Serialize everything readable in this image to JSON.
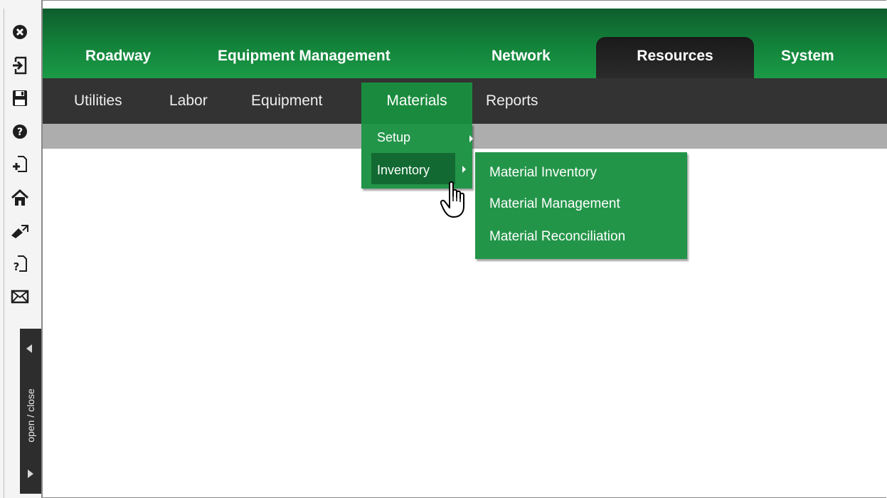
{
  "colors": {
    "nav_green": "#13843b",
    "menu_green": "#239549",
    "highlight_green": "#126a32",
    "subnav": "#333333",
    "active_tab": "#1a1a1a"
  },
  "toolbar": {
    "icons": [
      "close-circle-icon",
      "logout-icon",
      "save-icon",
      "help-icon",
      "new-page-icon",
      "home-icon",
      "edit-icon",
      "help-page-icon",
      "mail-icon"
    ],
    "open_close_label": "open / close"
  },
  "nav": {
    "tabs": [
      "Roadway",
      "Equipment Management",
      "Network",
      "Resources",
      "System"
    ],
    "active": "Resources"
  },
  "subnav": {
    "items": [
      "Utilities",
      "Labor",
      "Equipment",
      "Materials",
      "Reports"
    ],
    "active": "Materials"
  },
  "materials_menu": {
    "items": [
      "Setup",
      "Inventory"
    ],
    "highlighted": "Inventory"
  },
  "inventory_menu": {
    "items": [
      "Material Inventory",
      "Material Management",
      "Material Reconciliation"
    ]
  }
}
